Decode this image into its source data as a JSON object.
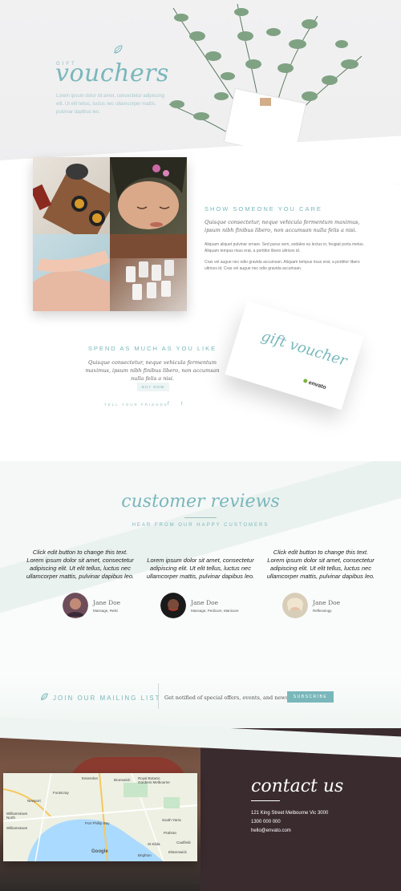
{
  "hero": {
    "kicker": "GIFT",
    "title": "vouchers",
    "text": "Lorem ipsum dolor sit amet, consectetur adipiscing elit. Ut elit tellus, luctus nec ullamcorper mattis, pulvinar dapibus leo."
  },
  "feature": {
    "heading": "SHOW SOMEONE YOU CARE",
    "quote": "Quisque consectetur, neque vehicula fermentum maximus, ipsum nibh finibus libero, non accumsan nulla felis a nisi.",
    "paragraph1": "Aliquam aliquet pulvinar ornare. Sed purus sem, sodales eu lectus in, feugiat porta metus. Aliquam tempus risus erat, a porttitor libero ultrices id.",
    "paragraph2": "Cras vel augue nec odio gravida accumsan. Aliquam tempus risus erat, a porttitor libero ultrices id. Cras vel augue nec odio gravida accumsan."
  },
  "spend": {
    "heading": "SPEND AS MUCH AS YOU LIKE",
    "quote": "Quisque consectetur, neque vehicula fermentum maximus, ipsum nibh finibus libero, non accumsan nulla felis a nisi.",
    "buy_label": "BUY NOW",
    "tell_label": "TELL YOUR FRIENDS",
    "facebook": "f",
    "twitter": "t"
  },
  "card": {
    "script": "gift voucher",
    "brand": "envato"
  },
  "reviews": {
    "title": "customer reviews",
    "subtitle": "HEAR FROM OUR HAPPY CUSTOMERS",
    "items": [
      {
        "text": "Click edit button to change this text. Lorem ipsum dolor sit amet, consectetur adipiscing elit. Ut elit tellus, luctus nec ullamcorper mattis, pulvinar dapibus leo.",
        "name": "Jane Doe",
        "role": "Massage, Reiki"
      },
      {
        "text": "Lorem ipsum dolor sit amet, consectetur adipiscing elit. Ut elit tellus, luctus nec ullamcorper mattis, pulvinar dapibus leo.",
        "name": "Jane Doe",
        "role": "Massage, Pedicure, Manicure"
      },
      {
        "text": "Click edit button to change this text. Lorem ipsum dolor sit amet, consectetur adipiscing elit. Ut elit tellus, luctus nec ullamcorper mattis, pulvinar dapibus leo.",
        "name": "Jane Doe",
        "role": "Reflexology"
      }
    ]
  },
  "mailing": {
    "title": "JOIN OUR MAILING LIST",
    "text": "Get notified of special offers, events, and news",
    "subscribe_label": "SUBSCRIBE"
  },
  "map": {
    "labels": [
      "Essendon",
      "Brunswick",
      "Royal Botanic Gardens Melbourne",
      "Footscray",
      "Newport",
      "Williamstown North",
      "Williamstown",
      "South Yarra",
      "Prahran",
      "St Kilda",
      "Port Phillip Bay",
      "Elsternwick",
      "Brighton",
      "Caulfield"
    ],
    "brand": "Google"
  },
  "contact": {
    "title": "contact us",
    "address": "121 King Street Melbourne Vic 3000",
    "phone": "1300 000 000",
    "email": "hello@envato.com"
  },
  "colors": {
    "accent": "#7ab7bb",
    "footer": "#3a2b2f",
    "button_light": "#edf4f4"
  }
}
